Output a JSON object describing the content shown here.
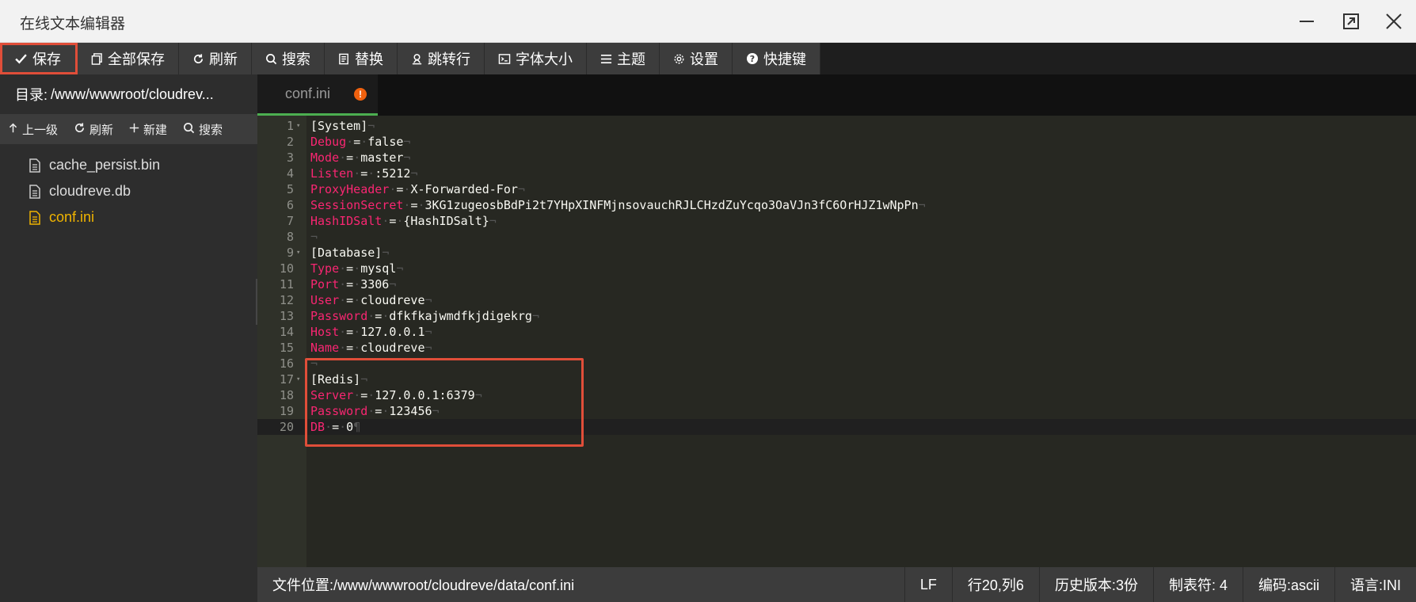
{
  "window": {
    "title": "在线文本编辑器",
    "controls": [
      "minimize",
      "maximize",
      "close"
    ]
  },
  "toolbar": {
    "items": [
      {
        "label": "保存",
        "icon": "check-icon"
      },
      {
        "label": "全部保存",
        "icon": "copy-icon"
      },
      {
        "label": "刷新",
        "icon": "refresh-icon"
      },
      {
        "label": "搜索",
        "icon": "search-icon"
      },
      {
        "label": "替换",
        "icon": "replace-icon"
      },
      {
        "label": "跳转行",
        "icon": "jump-icon"
      },
      {
        "label": "字体大小",
        "icon": "terminal-icon"
      },
      {
        "label": "主题",
        "icon": "menu-icon"
      },
      {
        "label": "设置",
        "icon": "gear-icon"
      },
      {
        "label": "快捷键",
        "icon": "help-icon"
      }
    ]
  },
  "sidebar": {
    "dir_label": "目录:",
    "dir_path": "/www/wwwroot/cloudrev...",
    "actions": [
      {
        "label": "上一级",
        "icon": "arrow-up-icon"
      },
      {
        "label": "刷新",
        "icon": "refresh-icon"
      },
      {
        "label": "新建",
        "icon": "plus-icon"
      },
      {
        "label": "搜索",
        "icon": "search-icon"
      }
    ],
    "files": [
      {
        "name": "cache_persist.bin",
        "active": false
      },
      {
        "name": "cloudreve.db",
        "active": false
      },
      {
        "name": "conf.ini",
        "active": true
      }
    ]
  },
  "tabs": [
    {
      "label": "conf.ini",
      "modified_badge": "!"
    }
  ],
  "editor": {
    "current_line": 20,
    "lines": [
      {
        "n": "1",
        "section": "[System]",
        "fold": true
      },
      {
        "n": "2",
        "key": "Debug",
        "value": "false"
      },
      {
        "n": "3",
        "key": "Mode",
        "value": "master"
      },
      {
        "n": "4",
        "key": "Listen",
        "value": ":5212"
      },
      {
        "n": "5",
        "key": "ProxyHeader",
        "value": "X-Forwarded-For"
      },
      {
        "n": "6",
        "key": "SessionSecret",
        "value": "3KG1zugeosbBdPi2t7YHpXINFMjnsovauchRJLCHzdZuYcqo3OaVJn3fC6OrHJZ1wNpPn"
      },
      {
        "n": "7",
        "key": "HashIDSalt",
        "value": "{HashIDSalt}"
      },
      {
        "n": "8"
      },
      {
        "n": "9",
        "section": "[Database]",
        "fold": true
      },
      {
        "n": "10",
        "key": "Type",
        "value": "mysql"
      },
      {
        "n": "11",
        "key": "Port",
        "value": "3306"
      },
      {
        "n": "12",
        "key": "User",
        "value": "cloudreve"
      },
      {
        "n": "13",
        "key": "Password",
        "value": "dfkfkajwmdfkjdigekrg"
      },
      {
        "n": "14",
        "key": "Host",
        "value": "127.0.0.1"
      },
      {
        "n": "15",
        "key": "Name",
        "value": "cloudreve"
      },
      {
        "n": "16"
      },
      {
        "n": "17",
        "section": "[Redis]",
        "fold": true
      },
      {
        "n": "18",
        "key": "Server",
        "value": "127.0.0.1:6379"
      },
      {
        "n": "19",
        "key": "Password",
        "value": "123456"
      },
      {
        "n": "20",
        "key": "DB",
        "value": "0"
      }
    ]
  },
  "statusbar": {
    "path": "文件位置:/www/wwwroot/cloudreve/data/conf.ini",
    "line_ending": "LF",
    "cursor": "行20,列6",
    "history": "历史版本:3份",
    "tab_size": "制表符: 4",
    "encoding": "编码:ascii",
    "language": "语言:INI"
  },
  "colors": {
    "highlight_box": "#e04e39",
    "key": "#f92672",
    "active_file": "#f0b400",
    "tab_underline": "#4caf50",
    "modified_badge": "#f0610e"
  }
}
